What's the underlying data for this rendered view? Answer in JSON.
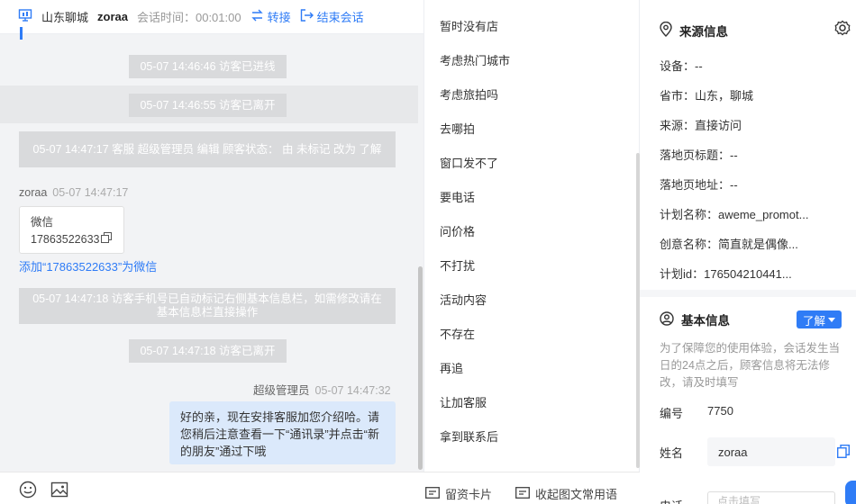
{
  "header": {
    "location": "山东聊城",
    "visitor": "zoraa",
    "session_time": "会话时间：00:01:00",
    "transfer": "转接",
    "end_session": "结束会话"
  },
  "chat": {
    "sys1": "05-07 14:46:46 访客已进线",
    "sys2": "05-07 14:46:55 访客已离开",
    "sys3": "05-07 14:47:17 客服 超级管理员 编辑 顾客状态： 由 未标记 改为 了解",
    "visitor_name": "zoraa",
    "visitor_time": "05-07 14:47:17",
    "card_title": "微信",
    "card_number": "17863522633",
    "add_link": "添加“17863522633”为微信",
    "sys4": "05-07 14:47:18 访客手机号已自动标记右侧基本信息栏，如需修改请在基本信息栏直接操作",
    "sys5": "05-07 14:47:18 访客已离开",
    "agent_name": "超级管理员",
    "agent_time": "05-07 14:47:32",
    "agent_msg": "好的亲，现在安排客服加您介绍哈。请您稍后注意查看一下“通讯录”并点击“新的朋友”通过下哦"
  },
  "bottom": {
    "keep_card": "留资卡片",
    "image_text": "收起图文常用语"
  },
  "replies": [
    "暂时没有店",
    "考虑热门城市",
    "考虑旅拍吗",
    "去哪拍",
    "窗口发不了",
    "要电话",
    "问价格",
    "不打扰",
    "活动内容",
    "不存在",
    "再追",
    "让加客服",
    "拿到联系后"
  ],
  "source": {
    "title": "来源信息",
    "device": "设备：--",
    "province": "省市：山东，聊城",
    "from": "来源：直接访问",
    "landing_title": "落地页标题：--",
    "landing_url": "落地页地址：--",
    "plan_name": "计划名称：aweme_promot...",
    "creative_name": "创意名称：简直就是偶像...",
    "plan_id": "计划id：176504210441..."
  },
  "basic": {
    "title": "基本信息",
    "status_pill": "了解",
    "note": "为了保障您的使用体验，会话发生当日的24点之后，顾客信息将无法修改，请及时填写",
    "id_label": "编号",
    "id_value": "7750",
    "name_label": "姓名",
    "name_value": "zoraa",
    "next_label": "电话",
    "next_placeholder": "点击填写"
  },
  "colors": {
    "accent": "#2f7cf6",
    "bubble": "#dbe9fb",
    "system": "#d9dadc"
  }
}
